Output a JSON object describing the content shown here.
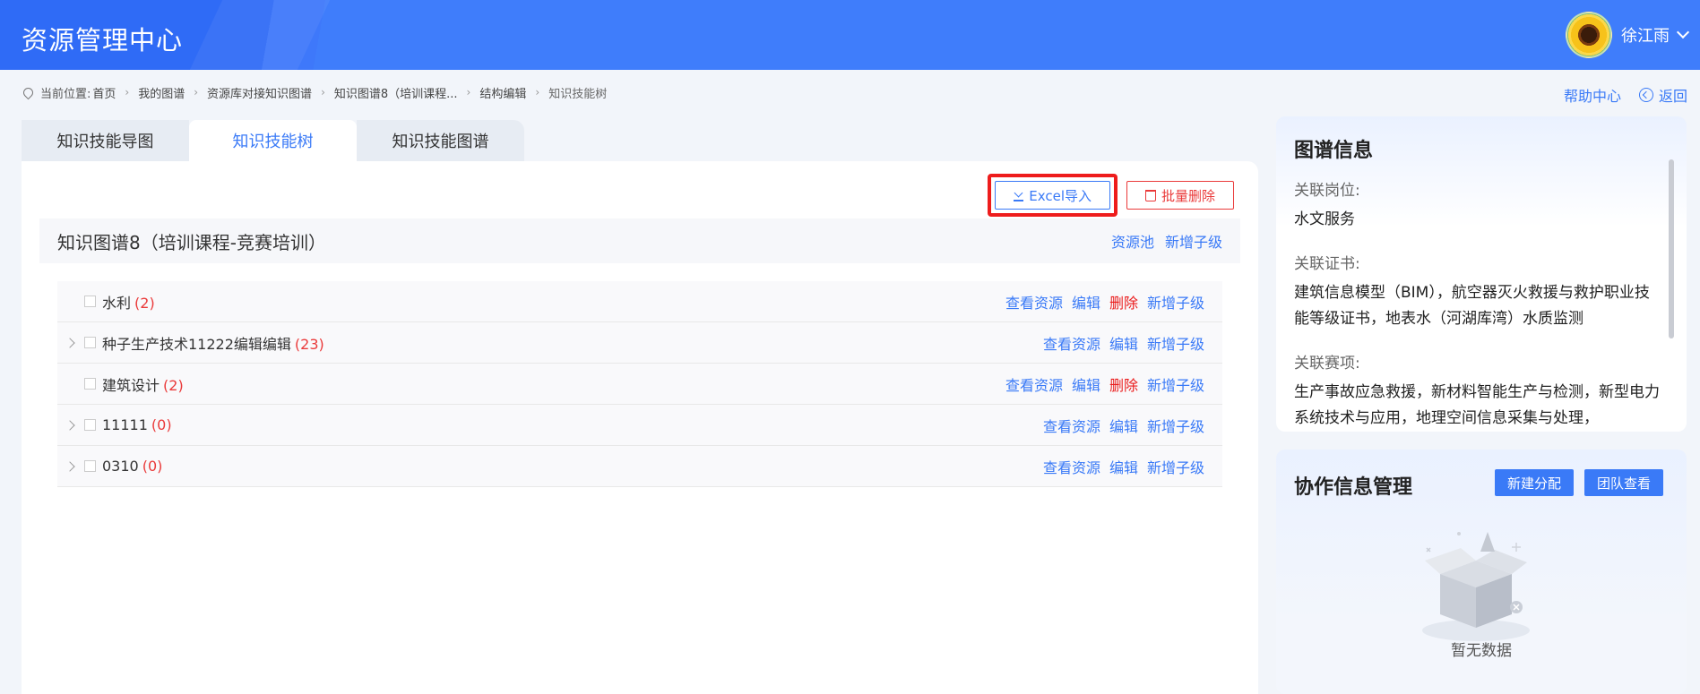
{
  "header": {
    "title": "资源管理中心",
    "user_name": "徐江雨"
  },
  "breadcrumb": {
    "label": "当前位置:",
    "items": [
      "首页",
      "我的图谱",
      "资源库对接知识图谱",
      "知识图谱8（培训课程...",
      "结构编辑",
      "知识技能树"
    ],
    "help": "帮助中心",
    "back": "返回"
  },
  "tabs": [
    {
      "label": "知识技能导图",
      "active": false
    },
    {
      "label": "知识技能树",
      "active": true
    },
    {
      "label": "知识技能图谱",
      "active": false
    }
  ],
  "toolbar": {
    "excel_label": "Excel导入",
    "delete_label": "批量删除"
  },
  "graph": {
    "title": "知识图谱8（培训课程-竞赛培训）",
    "pool": "资源池",
    "add_child": "新增子级"
  },
  "tree_rows": [
    {
      "name": "水利",
      "count": "(2)",
      "expandable": false,
      "actions": [
        "查看资源",
        "编辑",
        "删除",
        "新增子级"
      ]
    },
    {
      "name": "种子生产技术11222编辑编辑",
      "count": "(23)",
      "expandable": true,
      "actions": [
        "查看资源",
        "编辑",
        "新增子级"
      ]
    },
    {
      "name": "建筑设计",
      "count": "(2)",
      "expandable": false,
      "actions": [
        "查看资源",
        "编辑",
        "删除",
        "新增子级"
      ]
    },
    {
      "name": "11111",
      "count": "(0)",
      "expandable": true,
      "actions": [
        "查看资源",
        "编辑",
        "新增子级"
      ]
    },
    {
      "name": "0310",
      "count": "(0)",
      "expandable": true,
      "actions": [
        "查看资源",
        "编辑",
        "新增子级"
      ]
    }
  ],
  "info": {
    "title": "图谱信息",
    "post_label": "关联岗位:",
    "post_value": "水文服务",
    "cert_label": "关联证书:",
    "cert_value": "建筑信息模型（BIM），航空器灭火救援与救护职业技能等级证书，地表水（河湖库湾）水质监测",
    "comp_label": "关联赛项:",
    "comp_value": "生产事故应急救援，新材料智能生产与检测，新型电力系统技术与应用，地理空间信息采集与处理，"
  },
  "collab": {
    "title": "协作信息管理",
    "new_assign": "新建分配",
    "team_view": "团队查看",
    "empty": "暂无数据"
  },
  "colors": {
    "accent": "#3a7af7",
    "danger": "#ea3a3a",
    "header": "#3f7dfb"
  }
}
